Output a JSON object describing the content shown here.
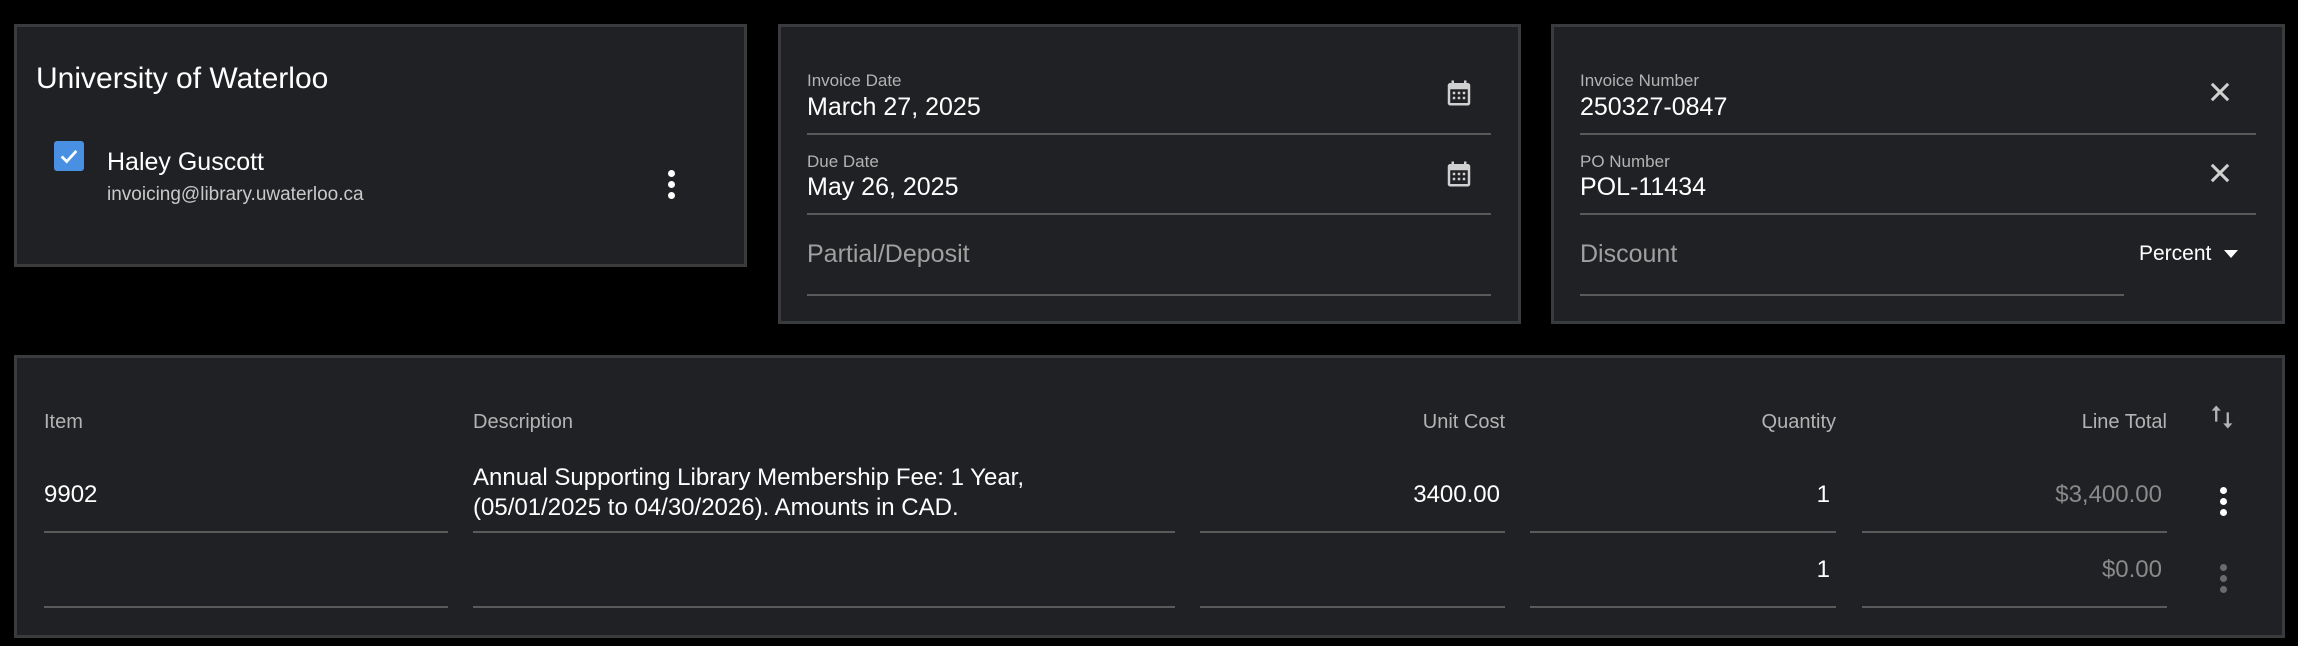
{
  "client": {
    "name": "University of Waterloo",
    "contact_name": "Haley Guscott",
    "contact_email": "invoicing@library.uwaterloo.ca",
    "contact_checked": true
  },
  "dates": {
    "invoice_date_label": "Invoice Date",
    "invoice_date_value": "March 27, 2025",
    "due_date_label": "Due Date",
    "due_date_value": "May 26, 2025",
    "partial_placeholder": "Partial/Deposit"
  },
  "numbers": {
    "invoice_number_label": "Invoice Number",
    "invoice_number_value": "250327-0847",
    "po_number_label": "PO Number",
    "po_number_value": "POL-11434",
    "discount_placeholder": "Discount",
    "discount_type": "Percent"
  },
  "line_items": {
    "headers": {
      "item": "Item",
      "description": "Description",
      "unit_cost": "Unit Cost",
      "quantity": "Quantity",
      "line_total": "Line Total"
    },
    "rows": [
      {
        "item": "9902",
        "description_line1": "Annual Supporting Library Membership Fee: 1 Year,",
        "description_line2": "(05/01/2025 to 04/30/2026). Amounts in CAD.",
        "unit_cost": "3400.00",
        "quantity": "1",
        "line_total": "$3,400.00"
      },
      {
        "item": "",
        "description_line1": "",
        "description_line2": "",
        "unit_cost": "",
        "quantity": "1",
        "line_total": "$0.00"
      }
    ]
  },
  "colors": {
    "background": "#000000",
    "card": "#202124",
    "accent_checkbox": "#4a90e2"
  }
}
